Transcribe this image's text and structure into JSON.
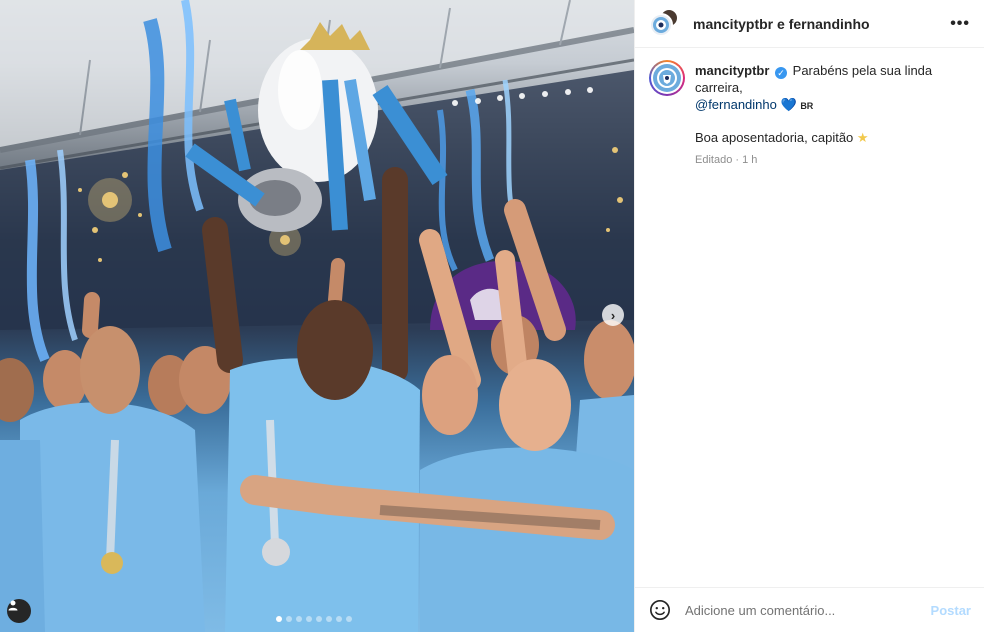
{
  "colors": {
    "accent": "#0095f6",
    "post_disabled": "#b3dbff",
    "city_blue": "#6cabdd"
  },
  "header": {
    "title": "mancityptbr e fernandinho",
    "more_icon": "more-horizontal-icon"
  },
  "caption": {
    "username": "mancityptbr",
    "text1": "Parabéns pela sua linda carreira,",
    "mention": "@fernandinho",
    "heart": "💙",
    "flag": "BR",
    "text2": "Boa aposentadoria, capitão",
    "star": "★",
    "meta": "Editado · 1 h"
  },
  "media": {
    "next_glyph": "›",
    "carousel_count": 8,
    "carousel_active": 1
  },
  "footer": {
    "placeholder": "Adicione um comentário...",
    "post_label": "Postar"
  }
}
